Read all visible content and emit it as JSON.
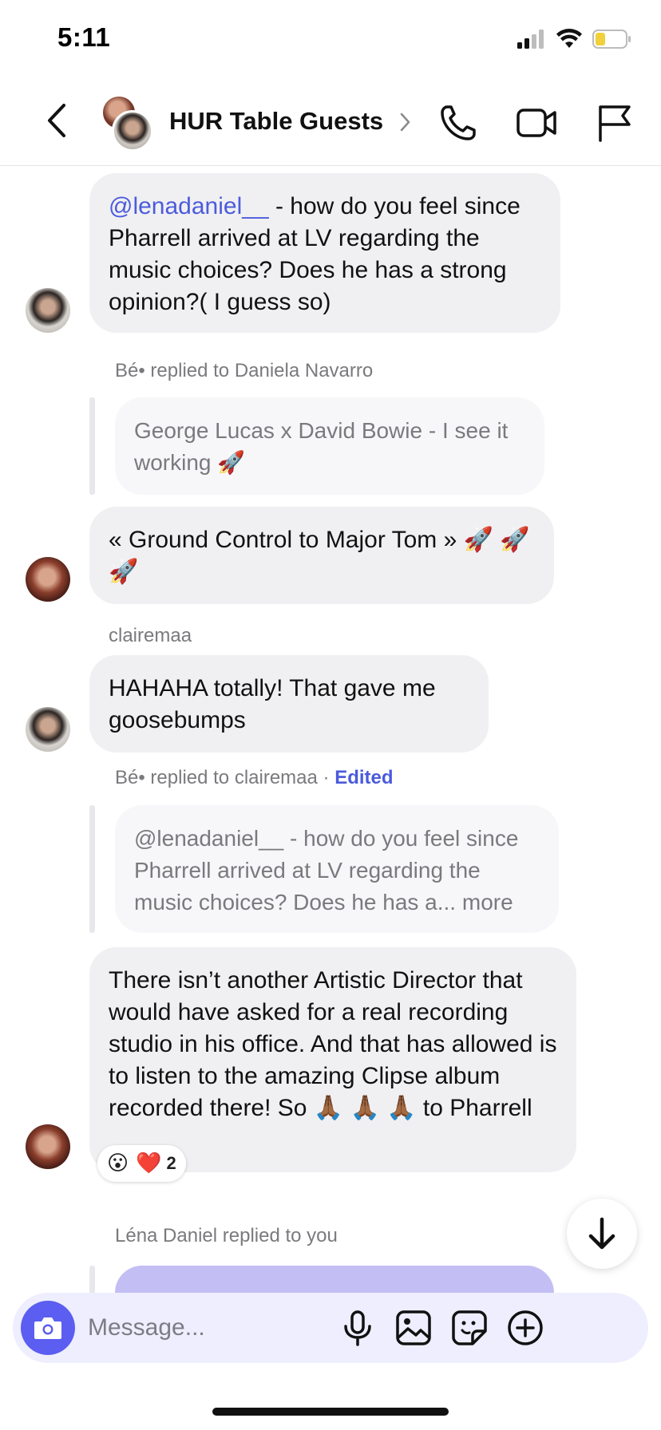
{
  "status_bar": {
    "time": "5:11"
  },
  "header": {
    "title": "HUR Table Guests"
  },
  "messages": [
    {
      "mention": "@lenadaniel__",
      "text": " - how do you feel since Pharrell arrived at LV regarding the music choices? Does he has a strong opinion?( I guess so)"
    },
    {
      "reply_meta": "Bé• replied to Daniela Navarro",
      "quote": "George Lucas x David Bowie - I see it working 🚀",
      "text": "« Ground Control to Major Tom » 🚀 🚀 🚀"
    },
    {
      "sender": "clairemaa",
      "text": "HAHAHA totally! That gave me goosebumps"
    },
    {
      "reply_meta": "Bé• replied to clairemaa",
      "edited": "Edited",
      "quote": "@lenadaniel__  - how do you feel since Pharrell arrived at LV regarding the music choices? Does he has a... more",
      "text": "There isn’t another Artistic Director that would have asked for a real recording studio in his office. And that has allowed is to listen to the amazing Clipse album recorded there! So 🙏🏾 🙏🏾 🙏🏾 to Pharrell",
      "reactions": {
        "emojis": "😮 ❤️",
        "count": "2"
      }
    },
    {
      "reply_meta": "Léna Daniel replied to you"
    }
  ],
  "composer": {
    "placeholder": "Message..."
  },
  "colors": {
    "accent": "#5b5ef0",
    "mention": "#4b5bdc",
    "bubble": "#f0f0f2"
  },
  "icons": [
    "back-icon",
    "chevron-right-icon",
    "phone-icon",
    "video-icon",
    "flag-icon",
    "camera-icon",
    "mic-icon",
    "image-icon",
    "sticker-icon",
    "plus-icon",
    "arrow-down-icon"
  ]
}
